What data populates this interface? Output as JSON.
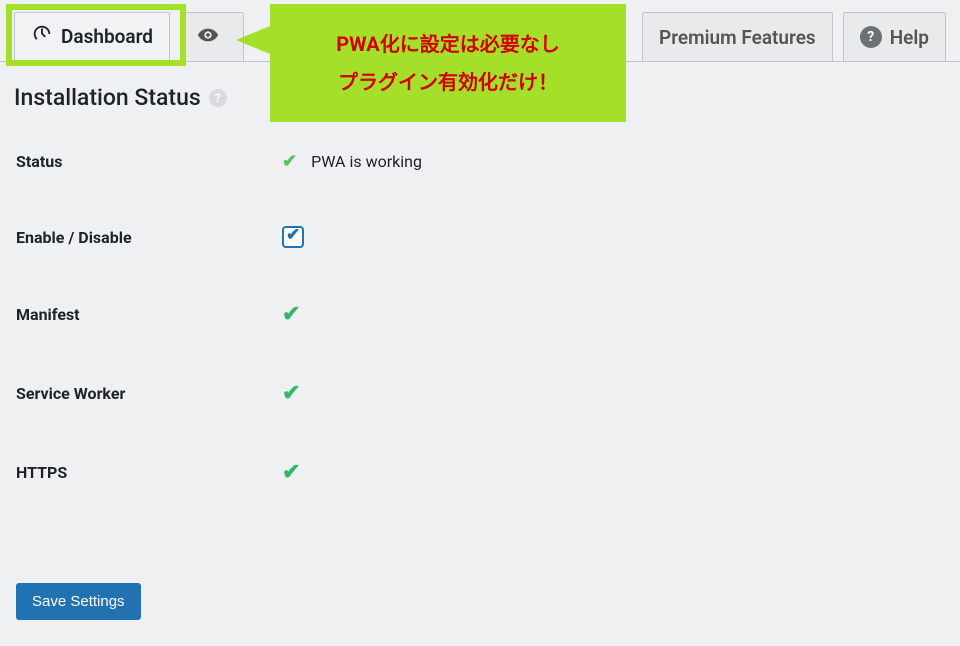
{
  "tabs": {
    "dashboard": "Dashboard",
    "visibility": "",
    "premium": "Premium Features",
    "help": "Help"
  },
  "callout": {
    "line1": "PWA化に設定は必要なし",
    "line2": "プラグイン有効化だけ！"
  },
  "section": {
    "title": "Installation Status"
  },
  "rows": {
    "status_label": "Status",
    "status_value": "PWA is working",
    "enable_label": "Enable / Disable",
    "manifest_label": "Manifest",
    "sw_label": "Service Worker",
    "https_label": "HTTPS"
  },
  "button": {
    "save": "Save Settings"
  },
  "state": {
    "enable_checked": true
  },
  "icons": {
    "gauge": "gauge-icon",
    "eye": "eye-icon",
    "help": "help-icon"
  }
}
